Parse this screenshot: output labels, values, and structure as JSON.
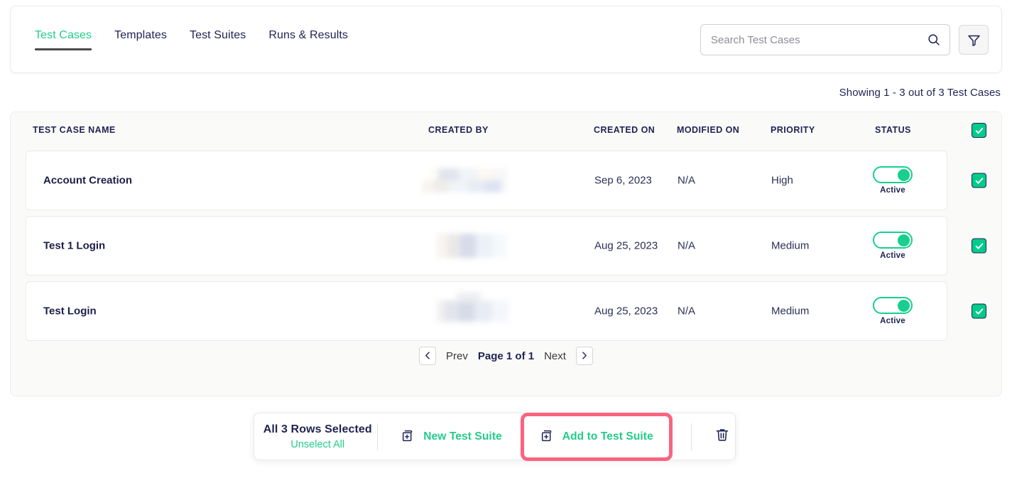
{
  "tabs": [
    {
      "label": "Test Cases",
      "active": true
    },
    {
      "label": "Templates",
      "active": false
    },
    {
      "label": "Test Suites",
      "active": false
    },
    {
      "label": "Runs & Results",
      "active": false
    }
  ],
  "search": {
    "placeholder": "Search Test Cases",
    "value": "",
    "icon": "search-icon"
  },
  "filter": {
    "icon": "funnel-icon"
  },
  "showing": "Showing 1 - 3 out of 3 Test Cases",
  "table": {
    "columns": [
      "TEST CASE NAME",
      "CREATED BY",
      "CREATED ON",
      "MODIFIED ON",
      "PRIORITY",
      "STATUS"
    ],
    "header_checkbox_checked": true,
    "rows": [
      {
        "name": "Account Creation",
        "created_by": "",
        "created_on": "Sep 6, 2023",
        "modified_on": "N/A",
        "priority": "High",
        "status": "Active",
        "status_on": true,
        "selected": true
      },
      {
        "name": "Test 1 Login",
        "created_by": "",
        "created_on": "Aug 25, 2023",
        "modified_on": "N/A",
        "priority": "Medium",
        "status": "Active",
        "status_on": true,
        "selected": true
      },
      {
        "name": "Test Login",
        "created_by": "",
        "created_on": "Aug 25, 2023",
        "modified_on": "N/A",
        "priority": "Medium",
        "status": "Active",
        "status_on": true,
        "selected": true
      }
    ]
  },
  "pagination": {
    "prev_label": "Prev",
    "page_label": "Page 1 of 1",
    "next_label": "Next",
    "prev_icon": "chevron-left-icon",
    "next_icon": "chevron-right-icon"
  },
  "action_bar": {
    "selected_title": "All 3 Rows Selected",
    "unselect_label": "Unselect All",
    "new_suite_label": "New Test Suite",
    "new_suite_icon": "copy-plus-icon",
    "add_suite_label": "Add to Test Suite",
    "add_suite_icon": "copy-plus-icon",
    "delete_icon": "trash-icon",
    "highlighted_action": "Add to Test Suite"
  },
  "colors": {
    "accent_green": "#22cc8a",
    "toggle_green": "#18cf8f",
    "checkbox_green": "#00cc8a",
    "navy": "#1f2352",
    "highlight_pink": "#f9647f",
    "panel_bg": "#fafaf8"
  }
}
